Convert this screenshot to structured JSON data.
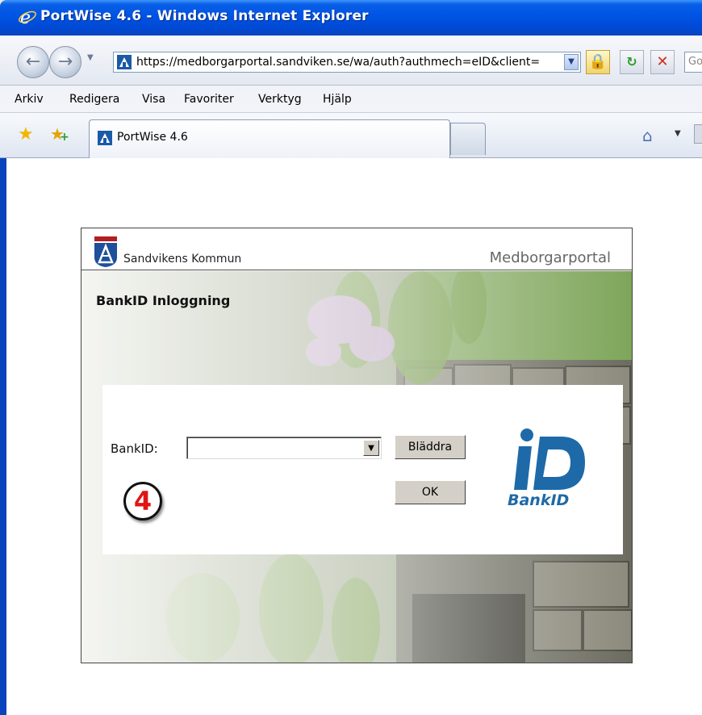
{
  "window": {
    "title": "PortWise 4.6 - Windows Internet Explorer"
  },
  "addressbar": {
    "url": "https://medborgarportal.sandviken.se/wa/auth?authmech=eID&client=",
    "search_placeholder": "Go"
  },
  "menu": {
    "items": [
      "Arkiv",
      "Redigera",
      "Visa",
      "Favoriter",
      "Verktyg",
      "Hjälp"
    ]
  },
  "tabs": {
    "active_label": "PortWise 4.6"
  },
  "portal": {
    "org_name": "Sandvikens Kommun",
    "portal_name": "Medborgarportal",
    "heading": "BankID Inloggning",
    "field_label": "BankID:",
    "select_value": "",
    "browse_label": "Bläddra",
    "ok_label": "OK",
    "step_number": "4",
    "logo_text": "BankID"
  },
  "colors": {
    "titlebar": "#0055e5",
    "step_number": "#e01515",
    "bankid_blue": "#1e6aa8"
  }
}
